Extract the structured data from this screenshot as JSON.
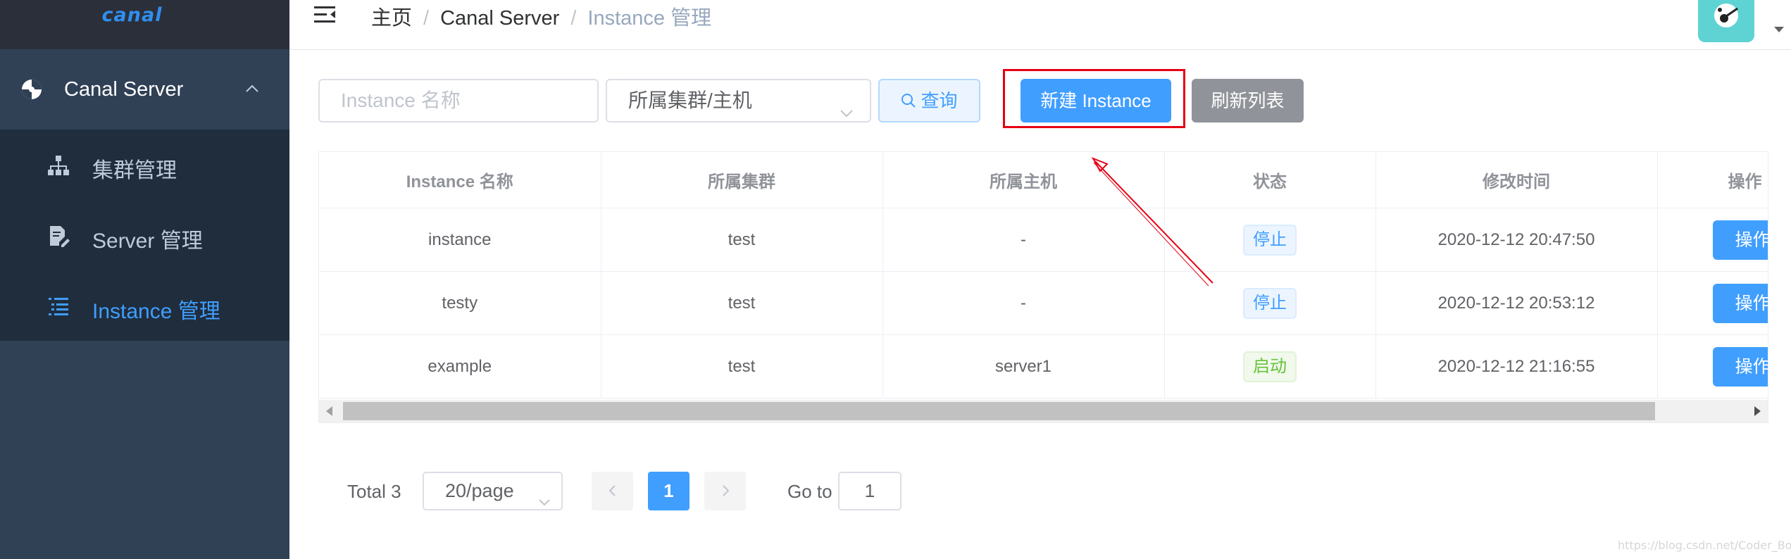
{
  "app": {
    "logo": "canal"
  },
  "sidebar": {
    "group_label": "Canal Server",
    "items": [
      {
        "label": "集群管理",
        "icon": "sitemap-icon"
      },
      {
        "label": "Server 管理",
        "icon": "document-edit-icon"
      },
      {
        "label": "Instance 管理",
        "icon": "list-icon",
        "active": true
      }
    ]
  },
  "header": {
    "breadcrumb": [
      "主页",
      "Canal Server",
      "Instance 管理"
    ],
    "separator": "/"
  },
  "filters": {
    "name_placeholder": "Instance 名称",
    "cluster_placeholder": "所属集群/主机",
    "search_label": "查询",
    "new_label": "新建 Instance",
    "refresh_label": "刷新列表"
  },
  "table": {
    "columns": [
      "Instance 名称",
      "所属集群",
      "所属主机",
      "状态",
      "修改时间",
      "操作"
    ],
    "rows": [
      {
        "name": "instance",
        "cluster": "test",
        "host": "-",
        "status": "停止",
        "modified": "2020-12-12 20:47:50",
        "action": "操作"
      },
      {
        "name": "testy",
        "cluster": "test",
        "host": "-",
        "status": "停止",
        "modified": "2020-12-12 20:53:12",
        "action": "操作"
      },
      {
        "name": "example",
        "cluster": "test",
        "host": "server1",
        "status": "启动",
        "modified": "2020-12-12 21:16:55",
        "action": "操作"
      }
    ]
  },
  "pagination": {
    "total": "Total 3",
    "page_size": "20/page",
    "current_page": "1",
    "goto_label": "Go to",
    "goto_value": "1"
  },
  "watermark": "https://blog.csdn.net/Coder_Boy_",
  "colors": {
    "sidebar_bg": "#304156",
    "submenu_bg": "#1f2d3d",
    "primary": "#409eff",
    "success": "#67c23a",
    "annotation": "#e60012"
  }
}
